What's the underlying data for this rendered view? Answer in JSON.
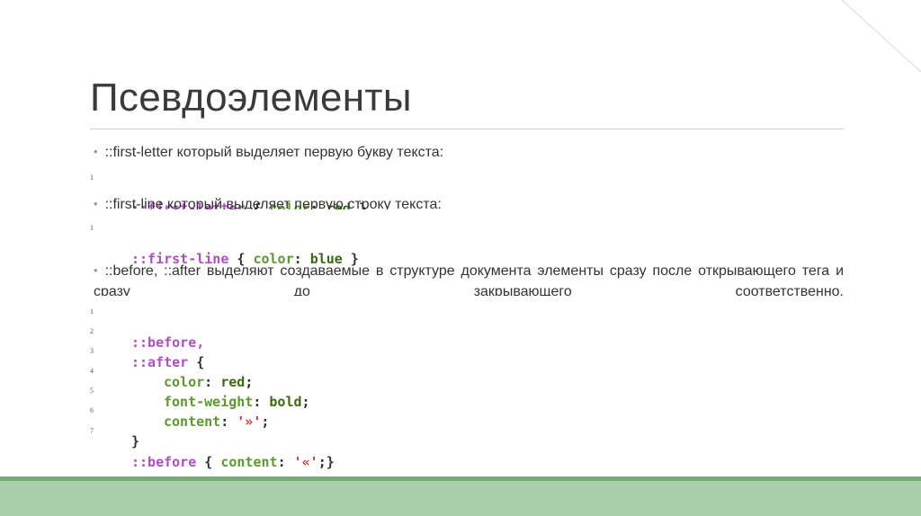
{
  "slide": {
    "title": "Псевдоэлементы",
    "bullets": [
      "::first-letter который выделяет первую букву текста:",
      "::first-line который выделяет первую строку текста:",
      "::before, ::after выделяют создаваемые в структуре документа элементы сразу после открывающего тега и сразу до закрывающего соответственно."
    ],
    "code1": {
      "num": "1",
      "sel": "::first-letter",
      "open": " { ",
      "prop": "color",
      "colon": ": ",
      "val": "red",
      "close": " }"
    },
    "code2": {
      "num": "1",
      "sel": "::first-line",
      "open": " { ",
      "prop": "color",
      "colon": ": ",
      "val": "blue",
      "close": " }"
    },
    "code3": {
      "lines": [
        {
          "num": "1",
          "a": "::before",
          "b": ","
        },
        {
          "num": "2",
          "a": "::after",
          "b": " {"
        },
        {
          "num": "3",
          "prop": "color",
          "val": "red",
          "end": ";"
        },
        {
          "num": "4",
          "prop": "font-weight",
          "val": "bold",
          "end": ";"
        },
        {
          "num": "5",
          "prop": "content",
          "str": "'»'",
          "end": ";"
        },
        {
          "num": "6",
          "brace": "}"
        },
        {
          "num": "7",
          "a": "::before",
          "open": " { ",
          "prop": "content",
          "str": "'«'",
          "end": ";}"
        }
      ]
    }
  },
  "colors": {
    "accent": "#7fa882",
    "bar": "#a9cfa8"
  }
}
